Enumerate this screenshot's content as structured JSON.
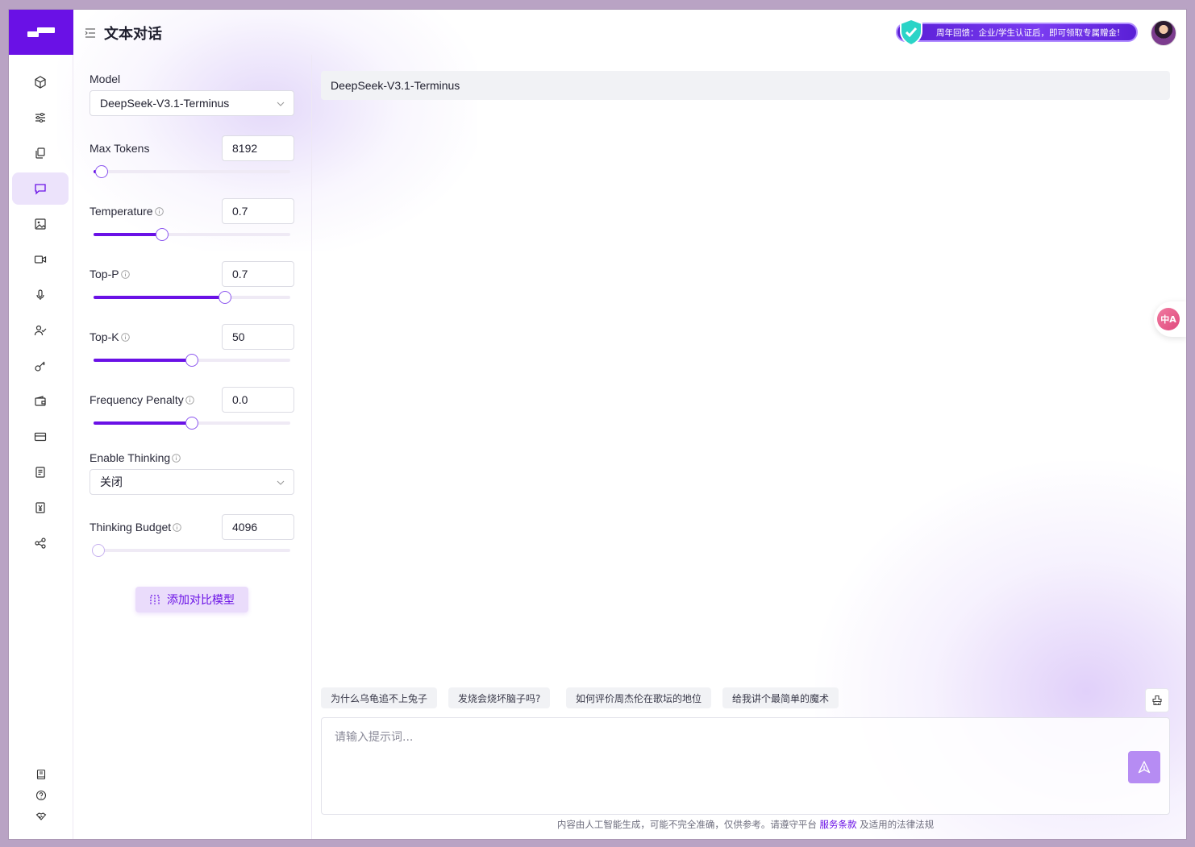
{
  "header": {
    "title": "文本对话",
    "promo_text": "周年回馈：企业/学生认证后，即可领取专属赠金!",
    "brand_color": "#6a11e6"
  },
  "sidebar": {
    "items": [
      {
        "icon": "cube-icon"
      },
      {
        "icon": "sliders-icon"
      },
      {
        "icon": "files-icon"
      },
      {
        "icon": "chat-icon",
        "active": true
      },
      {
        "icon": "image-icon"
      },
      {
        "icon": "video-icon"
      },
      {
        "icon": "microphone-icon"
      },
      {
        "icon": "user-check-icon"
      },
      {
        "icon": "key-icon"
      },
      {
        "icon": "wallet-icon"
      },
      {
        "icon": "credit-card-icon"
      },
      {
        "icon": "document-icon"
      },
      {
        "icon": "yen-icon"
      },
      {
        "icon": "share-icon"
      }
    ],
    "bottom_items": [
      {
        "icon": "book-icon"
      },
      {
        "icon": "help-icon"
      },
      {
        "icon": "handshake-icon"
      }
    ]
  },
  "settings": {
    "model_label": "Model",
    "model_value": "DeepSeek-V3.1-Terminus",
    "max_tokens": {
      "label": "Max Tokens",
      "value": "8192",
      "fraction": 0.04
    },
    "temperature": {
      "label": "Temperature",
      "value": "0.7",
      "fraction": 0.35
    },
    "top_p": {
      "label": "Top-P",
      "value": "0.7",
      "fraction": 0.67
    },
    "top_k": {
      "label": "Top-K",
      "value": "50",
      "fraction": 0.5
    },
    "frequency_penalty": {
      "label": "Frequency Penalty",
      "value": "0.0",
      "fraction": 0.5
    },
    "enable_thinking": {
      "label": "Enable Thinking",
      "value": "关闭"
    },
    "thinking_budget": {
      "label": "Thinking Budget",
      "value": "4096",
      "fraction": 0.0
    },
    "add_compare_label": "添加对比模型"
  },
  "main": {
    "model_name": "DeepSeek-V3.1-Terminus",
    "suggestions": [
      "为什么乌龟追不上兔子",
      "发烧会烧坏脑子吗?",
      "如何评价周杰伦在歌坛的地位",
      "给我讲个最简单的魔术"
    ],
    "input_placeholder": "请输入提示词...",
    "footer_prefix": "内容由人工智能生成，可能不完全准确，仅供参考。请遵守平台",
    "footer_link": "服务条款",
    "footer_suffix": "及适用的法律法规",
    "translate_label": "中A"
  }
}
